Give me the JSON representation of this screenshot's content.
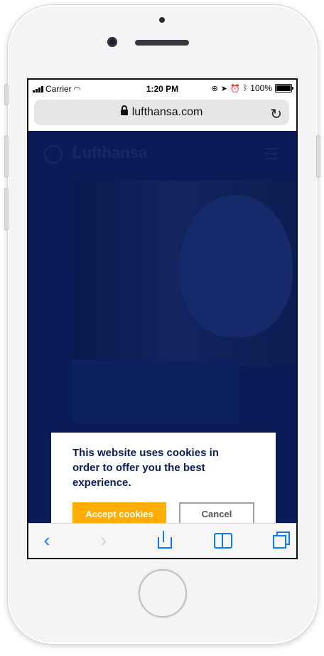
{
  "status_bar": {
    "carrier": "Carrier",
    "time": "1:20 PM",
    "battery": "100%"
  },
  "browser": {
    "url": "lufthansa.com"
  },
  "site": {
    "brand": "Lufthansa",
    "brand_color": "#0a1c57"
  },
  "cookie_dialog": {
    "message": "This website uses cookies in order to offer you the best experience.",
    "accept_label": "Accept cookies",
    "cancel_label": "Cancel",
    "accent_color": "#ffad00"
  },
  "toolbar": {
    "icons": [
      "back-icon",
      "forward-icon",
      "share-icon",
      "bookmarks-icon",
      "tabs-icon"
    ]
  }
}
